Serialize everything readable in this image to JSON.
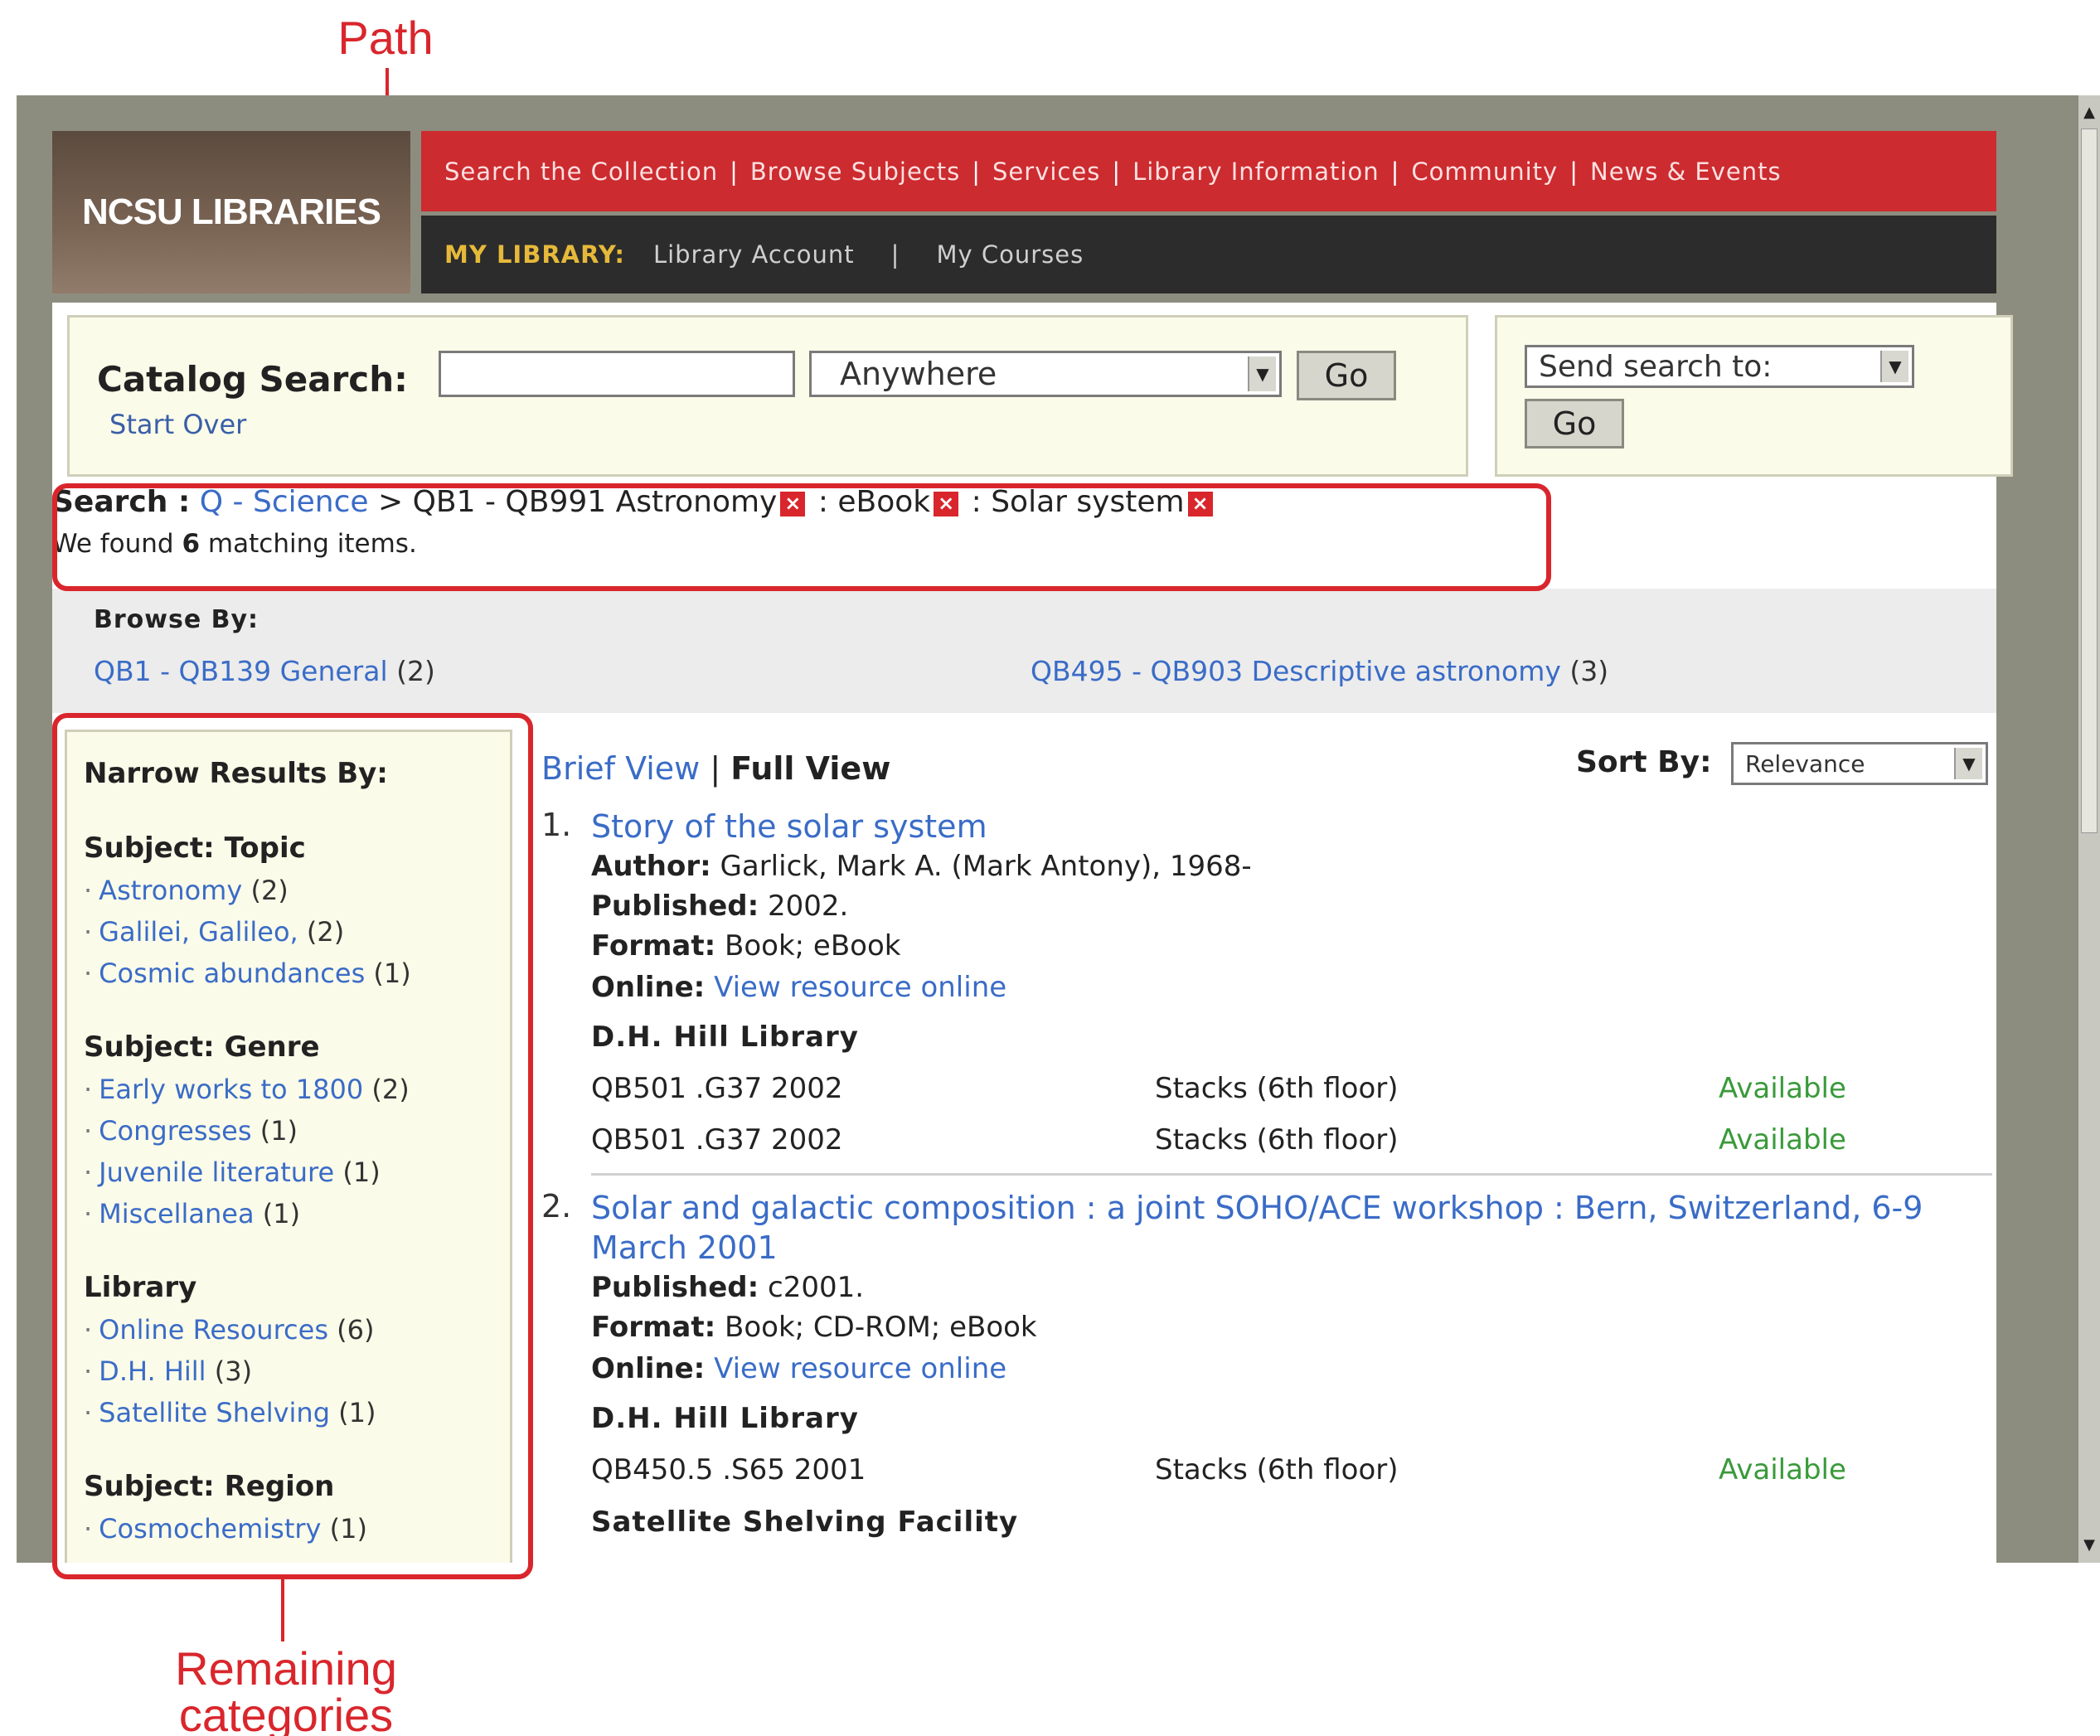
{
  "annotations": {
    "path_label": "Path",
    "remaining_label_line1": "Remaining",
    "remaining_label_line2": "categories"
  },
  "header": {
    "logo": "NCSU LIBRARIES",
    "nav": [
      "Search the Collection",
      "Browse Subjects",
      "Services",
      "Library Information",
      "Community",
      "News & Events"
    ],
    "my_library_label": "MY LIBRARY:",
    "my_library_links": [
      "Library Account",
      "My Courses"
    ]
  },
  "catalog_search": {
    "label": "Catalog Search:",
    "query_value": "",
    "scope_selected": "Anywhere",
    "go_label": "Go",
    "start_over": "Start Over"
  },
  "send_search": {
    "selected": "Send search to:",
    "go_label": "Go"
  },
  "path": {
    "label": "Search :",
    "crumbs": [
      {
        "text": "Q - Science",
        "link": true
      },
      {
        "text": "QB1 - QB991 Astronomy",
        "link": false,
        "removable": true
      },
      {
        "text": "eBook",
        "link": false,
        "removable": true
      },
      {
        "text": "Solar system",
        "link": false,
        "removable": true
      }
    ],
    "separator_gt": ">",
    "separator_colon": ":",
    "remove_symbol": "×",
    "found_prefix": "We found",
    "found_count": "6",
    "found_suffix": "matching items."
  },
  "browse_by": {
    "title": "Browse By:",
    "items": [
      {
        "label": "QB1 - QB139 General",
        "count": "(2)"
      },
      {
        "label": "QB495 - QB903 Descriptive astronomy",
        "count": "(3)"
      }
    ]
  },
  "narrow": {
    "title": "Narrow Results By:",
    "groups": [
      {
        "heading": "Subject: Topic",
        "items": [
          {
            "label": "Astronomy",
            "count": "(2)"
          },
          {
            "label": "Galilei, Galileo,",
            "count": "(2)"
          },
          {
            "label": "Cosmic abundances",
            "count": "(1)"
          }
        ]
      },
      {
        "heading": "Subject: Genre",
        "items": [
          {
            "label": "Early works to 1800",
            "count": "(2)"
          },
          {
            "label": "Congresses",
            "count": "(1)"
          },
          {
            "label": "Juvenile literature",
            "count": "(1)"
          },
          {
            "label": "Miscellanea",
            "count": "(1)"
          }
        ]
      },
      {
        "heading": "Library",
        "items": [
          {
            "label": "Online Resources",
            "count": "(6)"
          },
          {
            "label": "D.H. Hill",
            "count": "(3)"
          },
          {
            "label": "Satellite Shelving",
            "count": "(1)"
          }
        ]
      },
      {
        "heading": "Subject: Region",
        "items": [
          {
            "label": "Cosmochemistry",
            "count": "(1)"
          }
        ]
      }
    ]
  },
  "results": {
    "brief_view": "Brief View",
    "view_sep": "|",
    "full_view": "Full View",
    "sort_label": "Sort By:",
    "sort_selected": "Relevance",
    "records": [
      {
        "num": "1.",
        "title": "Story of the solar system",
        "author_label": "Author:",
        "author": "Garlick, Mark A. (Mark Antony), 1968-",
        "published_label": "Published:",
        "published": "2002.",
        "format_label": "Format:",
        "format": "Book; eBook",
        "online_label": "Online:",
        "online_link": "View resource online",
        "library": "D.H. Hill Library",
        "holdings": [
          {
            "call": "QB501 .G37 2002",
            "location": "Stacks (6th floor)",
            "status": "Available"
          },
          {
            "call": "QB501 .G37 2002",
            "location": "Stacks (6th floor)",
            "status": "Available"
          }
        ]
      },
      {
        "num": "2.",
        "title": "Solar and galactic composition : a joint SOHO/ACE workshop : Bern, Switzerland, 6-9 March 2001",
        "published_label": "Published:",
        "published": "c2001.",
        "format_label": "Format:",
        "format": "Book; CD-ROM; eBook",
        "online_label": "Online:",
        "online_link": "View resource online",
        "library": "D.H. Hill Library",
        "holdings": [
          {
            "call": "QB450.5 .S65 2001",
            "location": "Stacks (6th floor)",
            "status": "Available"
          }
        ],
        "library2": "Satellite Shelving Facility"
      }
    ]
  },
  "icons": {
    "dropdown_arrow": "▼",
    "scroll_up": "▲",
    "scroll_down": "▼",
    "facet_bullet": "·"
  },
  "colors": {
    "accent_red": "#cc2b2f",
    "annotation_red": "#d9262c",
    "link_blue": "#3a6cc7",
    "available_green": "#3a9a3a",
    "panel_cream": "#fbfbe9"
  }
}
